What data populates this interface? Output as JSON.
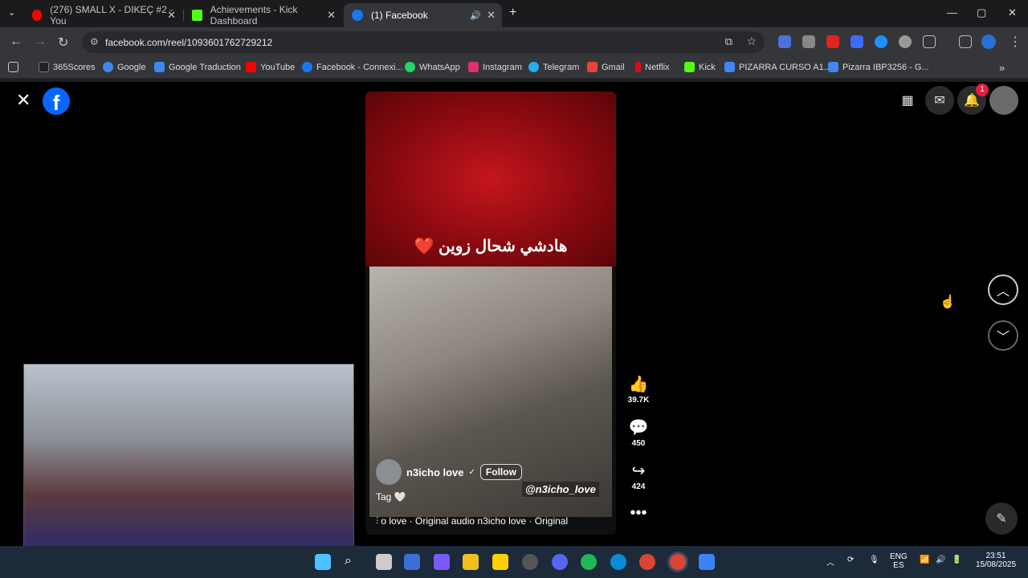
{
  "tabs": [
    {
      "title": "(276) SMALL X - DIKEÇ #2 - You",
      "favicon_color": "#ff0000"
    },
    {
      "title": "Achievements - Kick Dashboard",
      "favicon_color": "#53fc18"
    },
    {
      "title": "(1) Facebook",
      "favicon_color": "#1877f2"
    }
  ],
  "address_bar": {
    "url": "facebook.com/reel/1093601762729212"
  },
  "bookmarks": [
    {
      "label": "365Scores",
      "color": "#222"
    },
    {
      "label": "Google",
      "color": "#4285f4"
    },
    {
      "label": "Google Traduction",
      "color": "#4285f4"
    },
    {
      "label": "YouTube",
      "color": "#ff0000"
    },
    {
      "label": "Facebook - Connexi...",
      "color": "#1877f2"
    },
    {
      "label": "WhatsApp",
      "color": "#25d366"
    },
    {
      "label": "Instagram",
      "color": "#e1306c"
    },
    {
      "label": "Telegram",
      "color": "#2aabee"
    },
    {
      "label": "Gmail",
      "color": "#ea4335"
    },
    {
      "label": "Netflix",
      "color": "#e50914"
    },
    {
      "label": "Kick",
      "color": "#53fc18"
    },
    {
      "label": "PIZARRA CURSO A1...",
      "color": "#4285f4"
    },
    {
      "label": "Pizarra IBP3256 - G...",
      "color": "#4285f4"
    }
  ],
  "facebook": {
    "logo": "f",
    "notification_count": "1"
  },
  "reel": {
    "title_text": "هادشي شحال زوين",
    "heart": "❤️",
    "author": "n3icho love",
    "verified": "✓",
    "follow_label": "Follow",
    "caption": "Tag 🤍",
    "handle": "@n3icho_love",
    "audio": "o love · Original audio    n3icho love · Original",
    "likes": "39.7K",
    "comments": "450",
    "shares": "424"
  },
  "taskbar": {
    "lang_top": "ENG",
    "lang_bottom": "ES",
    "time": "23:51",
    "date": "15/08/2025"
  }
}
